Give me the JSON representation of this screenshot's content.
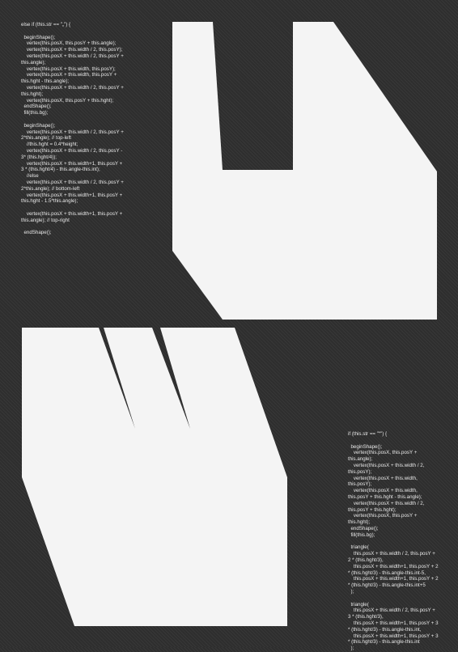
{
  "code_blocks": {
    "top": "else if (this.str == \"„\") {\n\n  beginShape();\n    vertex(this.posX, this.posY + this.angle);\n    vertex(this.posX + this.width / 2, this.posY);\n    vertex(this.posX + this.width / 2, this.posY + this.angle);\n    vertex(this.posX + this.width, this.posY);\n    vertex(this.posX + this.width, this.posY + this.hght - this.angle);\n    vertex(this.posX + this.width / 2, this.posY + this.hght);\n    vertex(this.posX, this.posY + this.hght);\n  endShape();\n  fill(this.bg);\n\n  beginShape();\n    vertex(this.posX + this.width / 2, this.posY + 2*this.angle); // top-left\n    //this.hght = 0.4*height;\n    vertex(this.posX + this.width / 2, this.posY - 3* (this.hght/4));\n    vertex(this.posX + this.width+1, this.posY + 3 * (this.hght/4) - this.angle-this.int);\n    //else\n    vertex(this.posX + this.width / 2, this.posY + 2*this.angle); // bottom-left\n    vertex(this.posX + this.width+1, this.posY + this.hght - 1.5*this.angle);\n\n    vertex(this.posX + this.width+1, this.posY + this.angle); // top-right\n\n  endShape();",
    "bottom": "if (this.str == \"“\") {\n\n  beginShape();\n    vertex(this.posX, this.posY + this.angle);\n    vertex(this.posX + this.width / 2, this.posY);\n    vertex(this.posX + this.width, this.posY);\n    vertex(this.posX + this.width, this.posY + this.hght - this.angle);\n    vertex(this.posX + this.width / 2, this.posY + this.hght);\n    vertex(this.posX, this.posY + this.hght);\n  endShape();\n  fill(this.bg);\n\n  triangle(\n    this.posX + this.width / 2, this.posY + 2 * (this.hght/3),\n    this.posX + this.width+1, this.posY + 2 * (this.hght/3) - this.angle-this.int-5,\n    this.posX + this.width+1, this.posY + 2 * (this.hght/3) - this.angle-this.int+5\n  );\n\n  triangle(\n    this.posX + this.width / 2, this.posY + 3 * (this.hght/3),\n    this.posX + this.width+1, this.posY + 3 * (this.hght/3) - this.angle-this.int,\n    this.posX + this.width+1, this.posY + 3 * (this.hght/3) - this.angle-this.int\n  );"
  },
  "colors": {
    "background": "#2e2e2e",
    "shape_fill": "#f4f4f4",
    "code_text": "#e8e8e8"
  }
}
